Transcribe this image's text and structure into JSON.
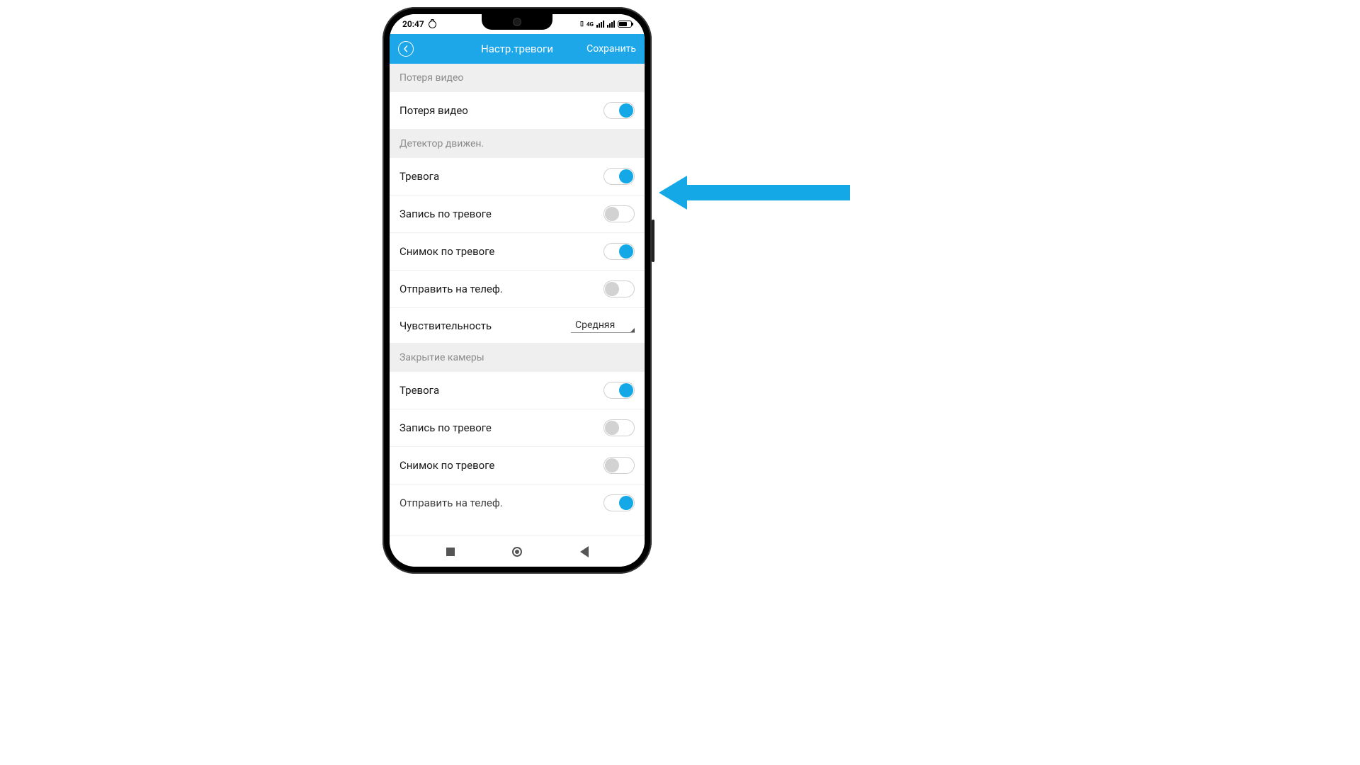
{
  "status": {
    "time": "20:47",
    "net_label": "4G"
  },
  "header": {
    "title": "Настр.тревоги",
    "save": "Сохранить"
  },
  "sections": {
    "video_loss": {
      "title": "Потеря видео",
      "rows": {
        "video_loss": {
          "label": "Потеря видео",
          "on": true
        }
      }
    },
    "motion": {
      "title": "Детектор движен.",
      "rows": {
        "alarm": {
          "label": "Тревога",
          "on": true
        },
        "record": {
          "label": "Запись по тревоге",
          "on": false
        },
        "snapshot": {
          "label": "Снимок по тревоге",
          "on": true
        },
        "send_phone": {
          "label": "Отправить на телеф.",
          "on": false
        },
        "sensitivity": {
          "label": "Чувствительность",
          "value": "Средняя"
        }
      }
    },
    "cover": {
      "title": "Закрытие камеры",
      "rows": {
        "alarm": {
          "label": "Тревога",
          "on": true
        },
        "record": {
          "label": "Запись по тревоге",
          "on": false
        },
        "snapshot": {
          "label": "Снимок по тревоге",
          "on": false
        },
        "send_phone": {
          "label": "Отправить на телеф.",
          "on": true
        }
      }
    }
  },
  "colors": {
    "accent": "#14a9e6",
    "header_bg": "#1ea7e8"
  }
}
